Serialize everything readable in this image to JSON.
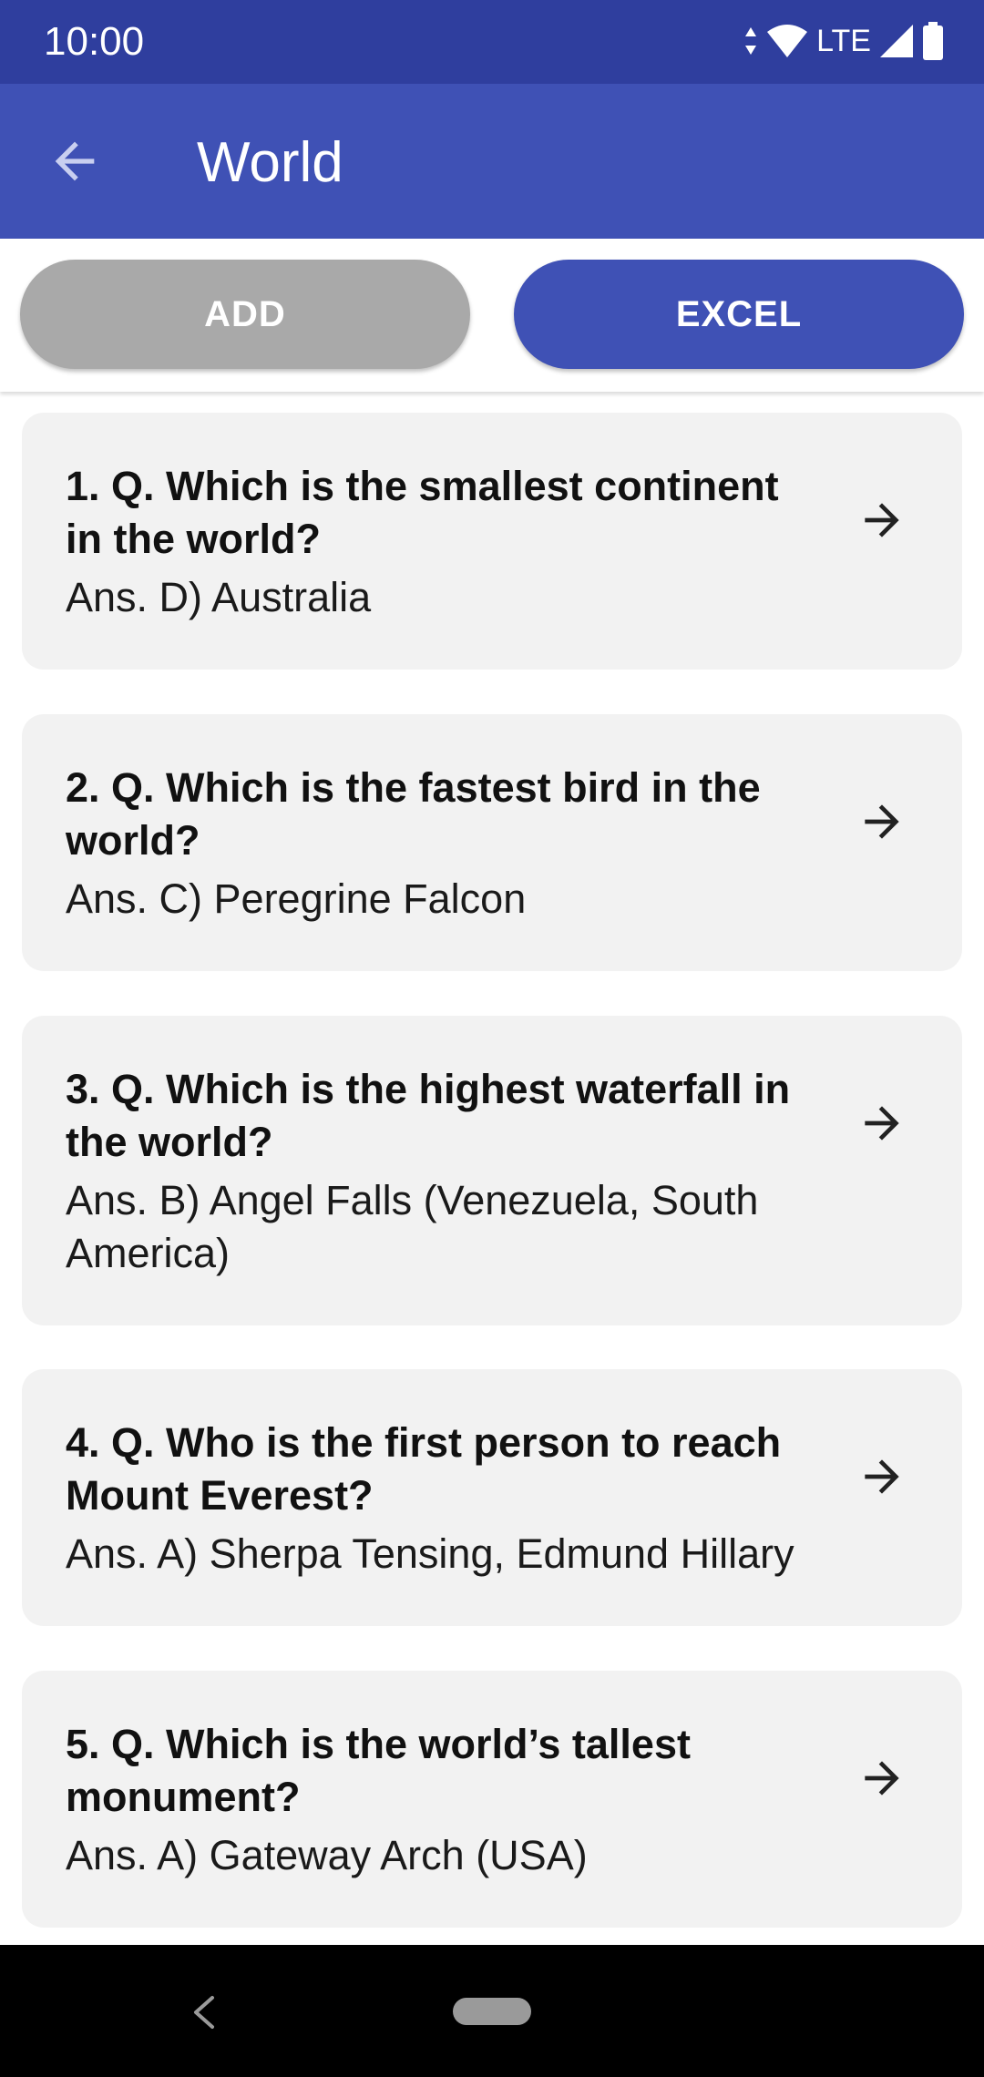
{
  "status_bar": {
    "time": "10:00",
    "network": "LTE"
  },
  "app_bar": {
    "title": "World",
    "back_icon": "arrow-left-icon"
  },
  "buttons": {
    "add_label": "ADD",
    "excel_label": "EXCEL"
  },
  "questions": [
    {
      "question": "1. Q. Which is the smallest continent in the world?",
      "answer": "Ans. D) Australia"
    },
    {
      "question": "2. Q. Which is the fastest bird in the world?",
      "answer": "Ans. C) Peregrine Falcon"
    },
    {
      "question": "3. Q. Which is the highest waterfall in the world?",
      "answer": "Ans. B) Angel Falls (Venezuela, South America)"
    },
    {
      "question": "4. Q. Who is the first person to reach Mount Everest?",
      "answer": "Ans. A) Sherpa Tensing, Edmund Hillary"
    },
    {
      "question": "5. Q. Which is the world’s tallest monument?",
      "answer": "Ans. A) Gateway Arch (USA)"
    }
  ],
  "colors": {
    "status_bar": "#2f3e9e",
    "primary": "#3f51b5",
    "add_button": "#a9a9a9",
    "card_background": "#f2f2f2"
  }
}
